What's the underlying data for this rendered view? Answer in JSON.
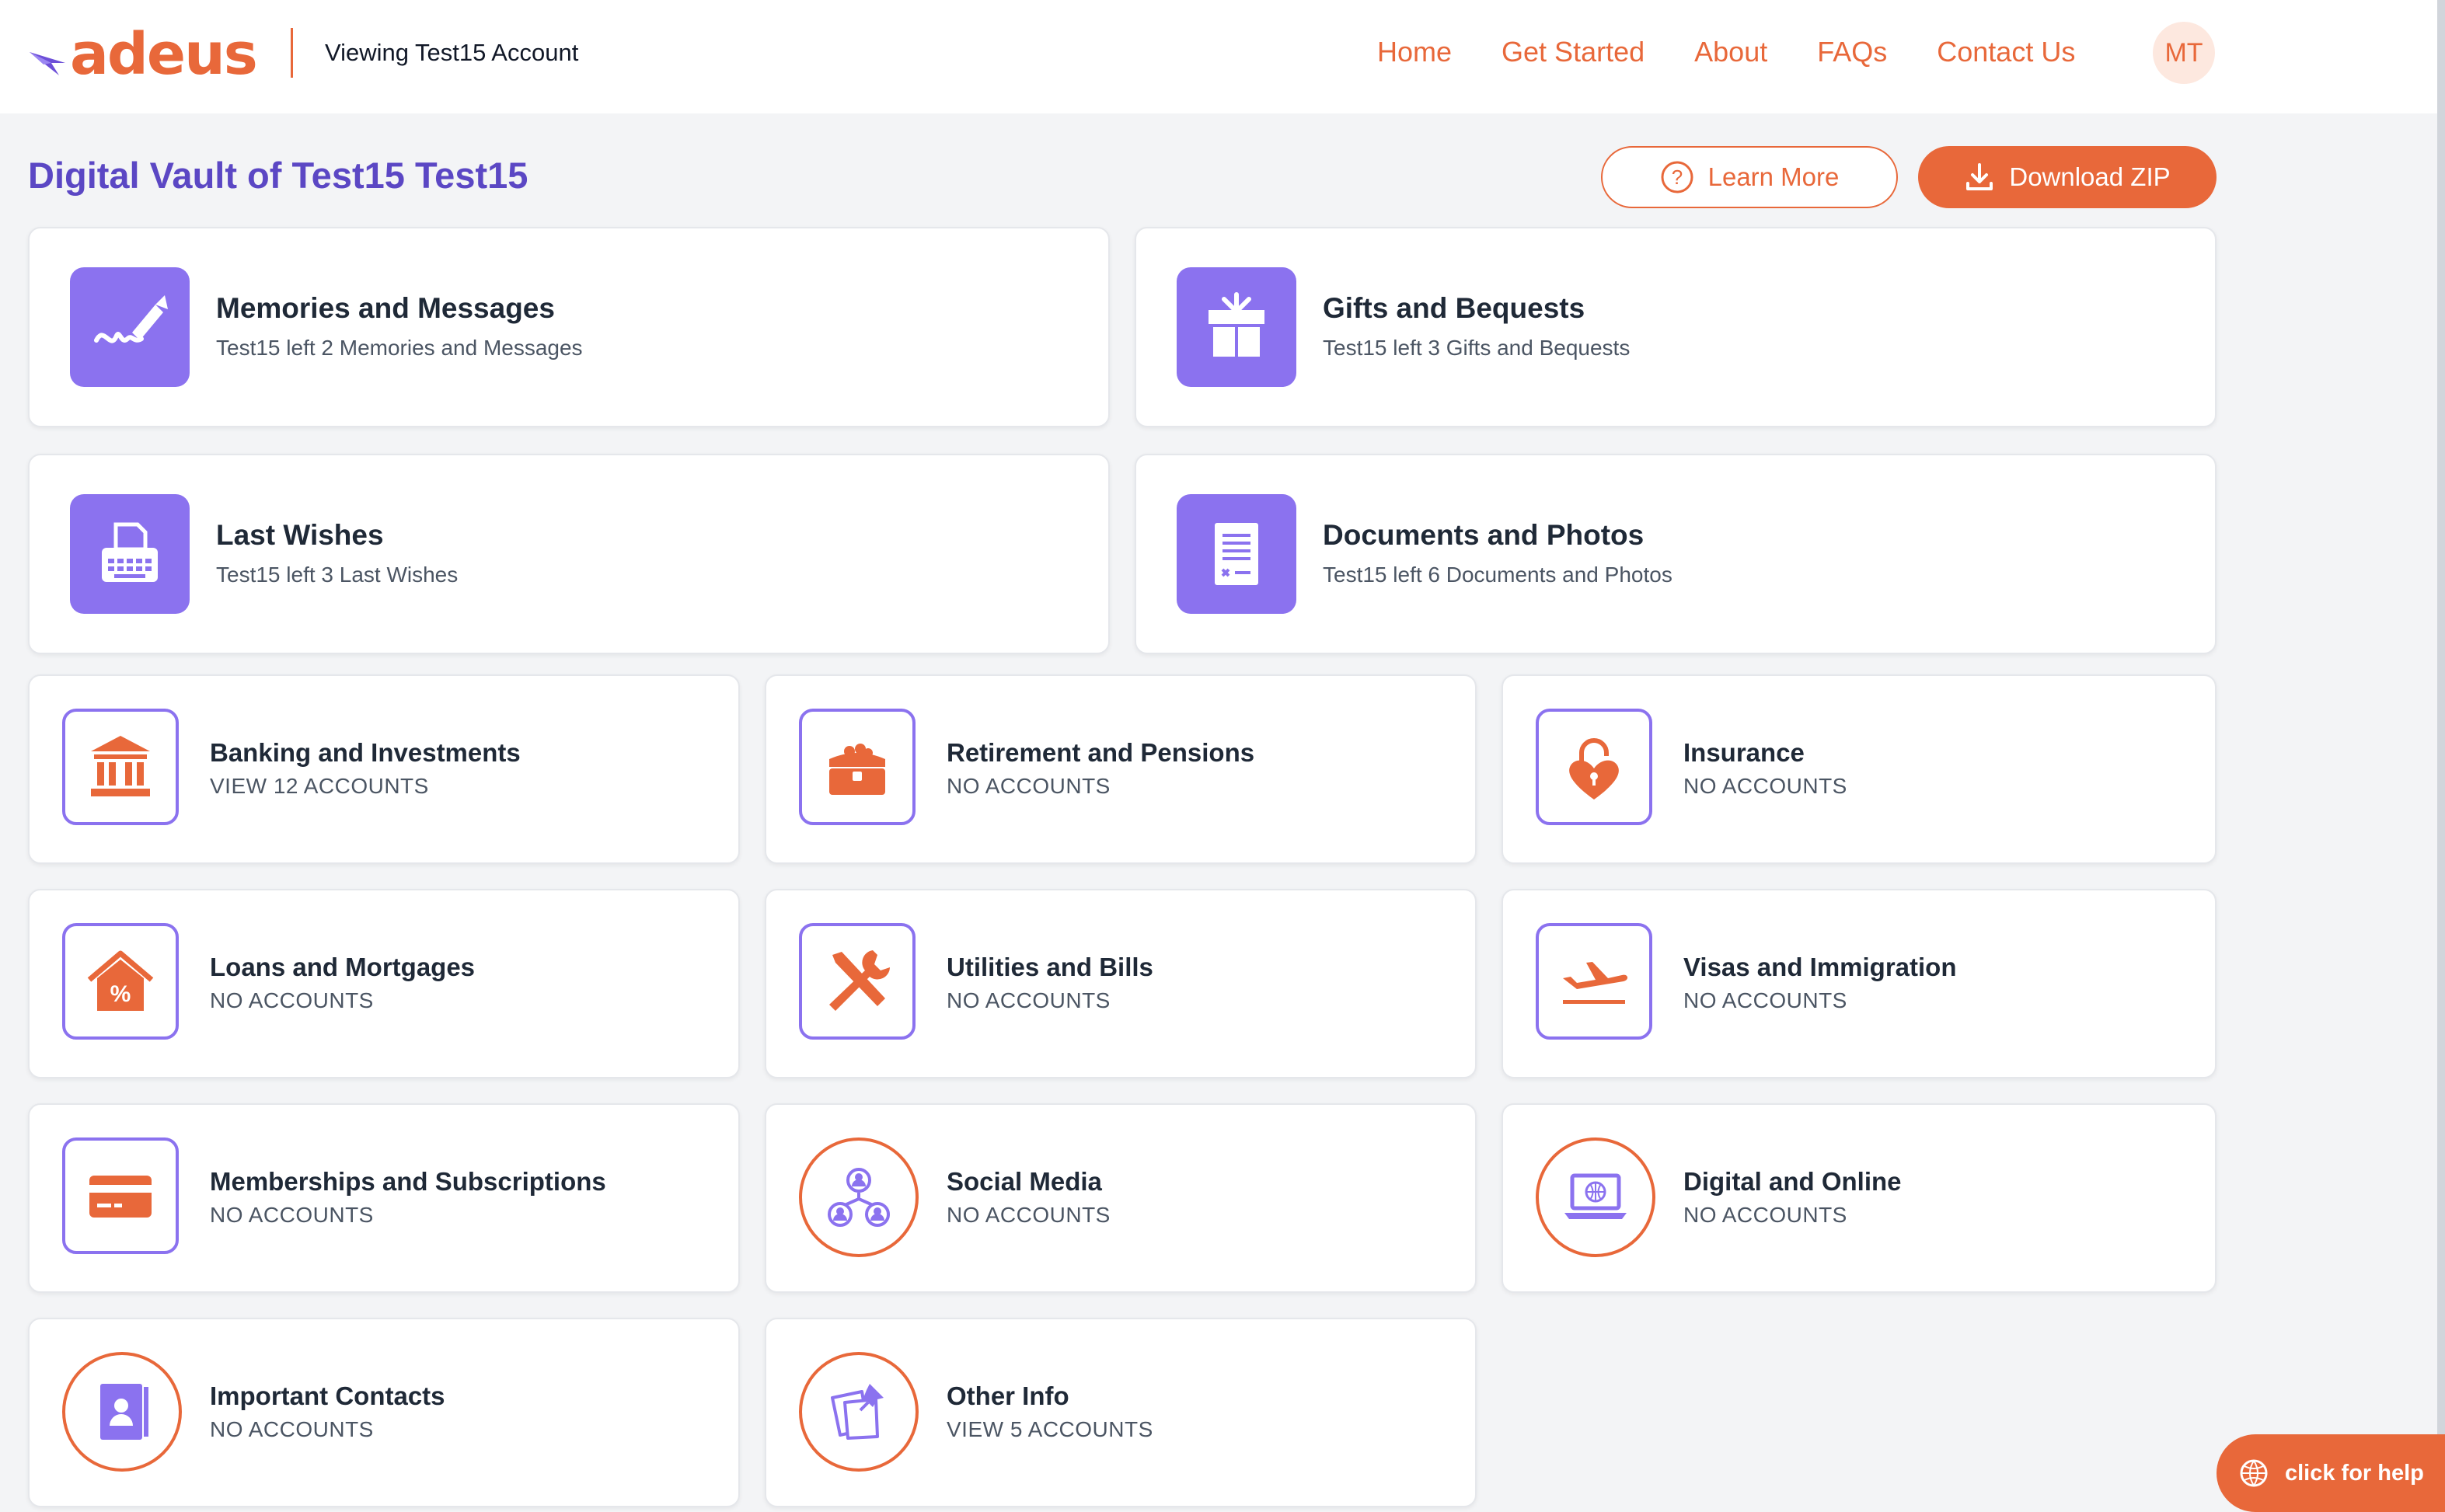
{
  "brand": {
    "name": "adeus",
    "accent": "#e8683a",
    "purple": "#8b72ef",
    "title_color": "#5b47c4"
  },
  "header": {
    "viewing_text": "Viewing Test15 Account",
    "nav": [
      {
        "label": "Home"
      },
      {
        "label": "Get Started"
      },
      {
        "label": "About"
      },
      {
        "label": "FAQs"
      },
      {
        "label": "Contact Us"
      }
    ],
    "avatar_initials": "MT"
  },
  "page": {
    "title": "Digital Vault of Test15 Test15",
    "learn_more_label": "Learn More",
    "download_label": "Download ZIP"
  },
  "featured": [
    {
      "title": "Memories and Messages",
      "subtitle": "Test15 left 2 Memories and Messages",
      "icon": "pen-signature-icon"
    },
    {
      "title": "Gifts and Bequests",
      "subtitle": "Test15 left 3 Gifts and Bequests",
      "icon": "gift-icon"
    },
    {
      "title": "Last Wishes",
      "subtitle": "Test15 left 3 Last Wishes",
      "icon": "typewriter-icon"
    },
    {
      "title": "Documents and Photos",
      "subtitle": "Test15 left 6 Documents and Photos",
      "icon": "document-icon"
    }
  ],
  "categories": [
    {
      "title": "Banking and Investments",
      "status": "VIEW 12 ACCOUNTS",
      "icon": "bank-icon"
    },
    {
      "title": "Retirement and Pensions",
      "status": "NO ACCOUNTS",
      "icon": "treasure-chest-icon"
    },
    {
      "title": "Insurance",
      "status": "NO ACCOUNTS",
      "icon": "heart-lock-icon"
    },
    {
      "title": "Loans and Mortgages",
      "status": "NO ACCOUNTS",
      "icon": "house-percent-icon"
    },
    {
      "title": "Utilities and Bills",
      "status": "NO ACCOUNTS",
      "icon": "tools-icon"
    },
    {
      "title": "Visas and Immigration",
      "status": "NO ACCOUNTS",
      "icon": "airplane-icon"
    },
    {
      "title": "Memberships and Subscriptions",
      "status": "NO ACCOUNTS",
      "icon": "credit-card-icon"
    },
    {
      "title": "Social Media",
      "status": "NO ACCOUNTS",
      "icon": "people-network-icon"
    },
    {
      "title": "Digital and Online",
      "status": "NO ACCOUNTS",
      "icon": "laptop-globe-icon"
    },
    {
      "title": "Important Contacts",
      "status": "NO ACCOUNTS",
      "icon": "contact-book-icon"
    },
    {
      "title": "Other Info",
      "status": "VIEW 5 ACCOUNTS",
      "icon": "pinned-notes-icon"
    }
  ],
  "help": {
    "label": "click for help"
  }
}
